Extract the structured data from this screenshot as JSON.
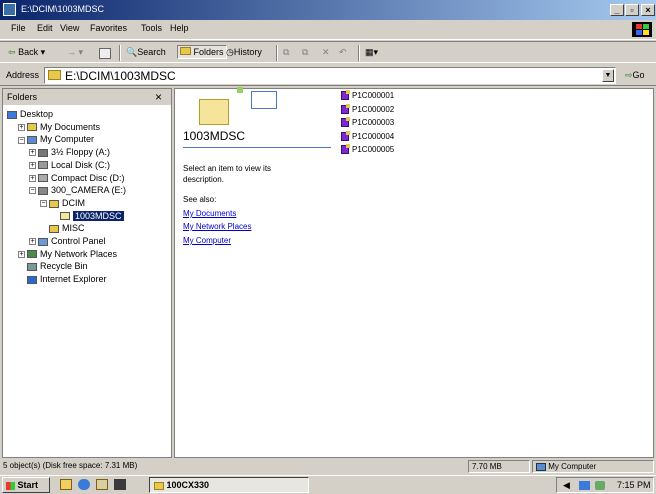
{
  "window": {
    "title": "E:\\DCIM\\1003MDSC"
  },
  "menu": [
    "File",
    "Edit",
    "View",
    "Favorites",
    "Tools",
    "Help"
  ],
  "toolbar": {
    "back": "Back",
    "forward": "→",
    "search": "Search",
    "folders": "Folders",
    "history": "History"
  },
  "address": {
    "label": "Address",
    "value": "E:\\DCIM\\1003MDSC",
    "go": "Go"
  },
  "folders_pane": {
    "title": "Folders",
    "close": "×",
    "tree": [
      {
        "label": "Desktop",
        "level": 0,
        "icon": "desktop-icon"
      },
      {
        "label": "My Documents",
        "level": 1,
        "icon": "my-documents-icon",
        "expander": "+"
      },
      {
        "label": "My Computer",
        "level": 1,
        "icon": "my-computer-icon",
        "expander": "−"
      },
      {
        "label": "3½ Floppy (A:)",
        "level": 2,
        "icon": "floppy-icon",
        "expander": "+"
      },
      {
        "label": "Local Disk (C:)",
        "level": 2,
        "icon": "hard-disk-icon",
        "expander": "+"
      },
      {
        "label": "Compact Disc (D:)",
        "level": 2,
        "icon": "cd-icon",
        "expander": "+"
      },
      {
        "label": "300_CAMERA (E:)",
        "level": 2,
        "icon": "removable-disk-icon",
        "expander": "−"
      },
      {
        "label": "DCIM",
        "level": 3,
        "icon": "folder-icon",
        "expander": "−"
      },
      {
        "label": "1003MDSC",
        "level": 4,
        "icon": "open-folder-icon",
        "selected": true
      },
      {
        "label": "MISC",
        "level": 3,
        "icon": "folder-icon"
      },
      {
        "label": "Control Panel",
        "level": 2,
        "icon": "control-panel-icon",
        "expander": "+"
      },
      {
        "label": "My Network Places",
        "level": 1,
        "icon": "network-icon",
        "expander": "+"
      },
      {
        "label": "Recycle Bin",
        "level": 1,
        "icon": "recycle-bin-icon"
      },
      {
        "label": "Internet Explorer",
        "level": 1,
        "icon": "ie-icon"
      }
    ]
  },
  "info_panel": {
    "folder_name": "1003MDSC",
    "description_1": "Select an item to view its",
    "description_2": "description.",
    "see_also": "See also:",
    "links": [
      "My Documents",
      "My Network Places",
      "My Computer"
    ]
  },
  "files": [
    "P1C000001",
    "P1C000002",
    "P1C000003",
    "P1C000004",
    "P1C000005"
  ],
  "status": {
    "objects": "5 object(s) (Disk free space: 7.31 MB)",
    "size": "7.70 MB",
    "location": "My Computer"
  },
  "taskbar": {
    "start": "Start",
    "task": "100CX330",
    "clock": "7:15 PM"
  },
  "colors": {
    "titlebar": "#0a246a",
    "selection": "#0a246a",
    "link": "#0000cc",
    "face": "#d4d0c8"
  }
}
